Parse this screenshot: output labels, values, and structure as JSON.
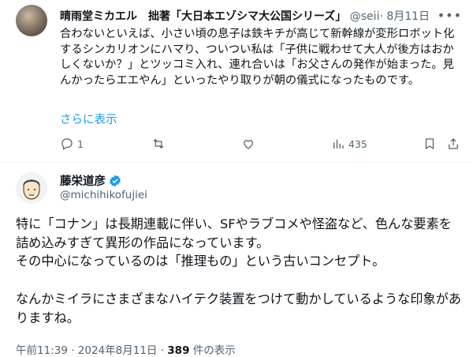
{
  "reply": {
    "name": "晴雨堂ミカエル　拙著「大日本エゾシマ大公国シリーズ」",
    "handle": "@seii",
    "date": "· 8月11日",
    "body": "合わないといえば、小さい頃の息子は鉄キチが高じて新幹線が変形ロボット化するシンカリオンにハマり、ついつい私は「子供に戦わせて大人が後方はおかしくないか？」とツッコミ入れ、連れ合いは「お父さんの発作が始まった。見んかったらエエやん」といったやり取りが朝の儀式になったものです。",
    "show_more": "さらに表示",
    "actions": {
      "reply_count": "1",
      "retweet_count": "",
      "like_count": "",
      "views_count": "435"
    }
  },
  "main": {
    "name": "藤栄道彦",
    "handle": "@michihikofujiei",
    "paragraphs": [
      "特に「コナン」は長期連載に伴い、SFやラブコメや怪盗など、色んな要素を詰め込みすぎて異形の作品になっています。",
      "その中心になっているのは「推理もの」という古いコンセプト。",
      "",
      "なんかミイラにさまざまなハイテク装置をつけて動かしているような印象がありますね。"
    ],
    "timestamp": "午前11:39 · 2024年8月11日 · ",
    "views": "389",
    "views_suffix": " 件の表示"
  },
  "colors": {
    "accent": "#1d9bf0",
    "muted": "#536471",
    "text": "#0f1419"
  }
}
